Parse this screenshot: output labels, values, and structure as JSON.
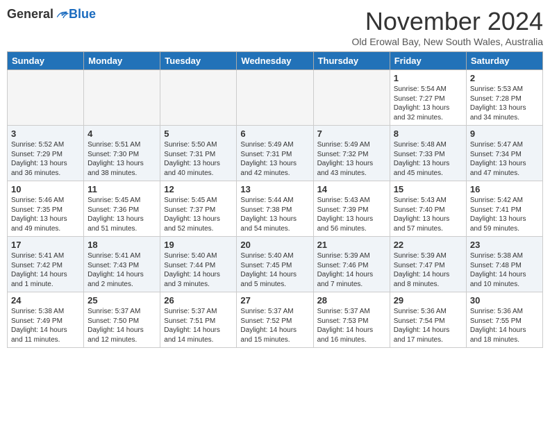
{
  "logo": {
    "general": "General",
    "blue": "Blue"
  },
  "title": "November 2024",
  "location": "Old Erowal Bay, New South Wales, Australia",
  "weekdays": [
    "Sunday",
    "Monday",
    "Tuesday",
    "Wednesday",
    "Thursday",
    "Friday",
    "Saturday"
  ],
  "weeks": [
    [
      {
        "day": "",
        "info": ""
      },
      {
        "day": "",
        "info": ""
      },
      {
        "day": "",
        "info": ""
      },
      {
        "day": "",
        "info": ""
      },
      {
        "day": "",
        "info": ""
      },
      {
        "day": "1",
        "info": "Sunrise: 5:54 AM\nSunset: 7:27 PM\nDaylight: 13 hours\nand 32 minutes."
      },
      {
        "day": "2",
        "info": "Sunrise: 5:53 AM\nSunset: 7:28 PM\nDaylight: 13 hours\nand 34 minutes."
      }
    ],
    [
      {
        "day": "3",
        "info": "Sunrise: 5:52 AM\nSunset: 7:29 PM\nDaylight: 13 hours\nand 36 minutes."
      },
      {
        "day": "4",
        "info": "Sunrise: 5:51 AM\nSunset: 7:30 PM\nDaylight: 13 hours\nand 38 minutes."
      },
      {
        "day": "5",
        "info": "Sunrise: 5:50 AM\nSunset: 7:31 PM\nDaylight: 13 hours\nand 40 minutes."
      },
      {
        "day": "6",
        "info": "Sunrise: 5:49 AM\nSunset: 7:31 PM\nDaylight: 13 hours\nand 42 minutes."
      },
      {
        "day": "7",
        "info": "Sunrise: 5:49 AM\nSunset: 7:32 PM\nDaylight: 13 hours\nand 43 minutes."
      },
      {
        "day": "8",
        "info": "Sunrise: 5:48 AM\nSunset: 7:33 PM\nDaylight: 13 hours\nand 45 minutes."
      },
      {
        "day": "9",
        "info": "Sunrise: 5:47 AM\nSunset: 7:34 PM\nDaylight: 13 hours\nand 47 minutes."
      }
    ],
    [
      {
        "day": "10",
        "info": "Sunrise: 5:46 AM\nSunset: 7:35 PM\nDaylight: 13 hours\nand 49 minutes."
      },
      {
        "day": "11",
        "info": "Sunrise: 5:45 AM\nSunset: 7:36 PM\nDaylight: 13 hours\nand 51 minutes."
      },
      {
        "day": "12",
        "info": "Sunrise: 5:45 AM\nSunset: 7:37 PM\nDaylight: 13 hours\nand 52 minutes."
      },
      {
        "day": "13",
        "info": "Sunrise: 5:44 AM\nSunset: 7:38 PM\nDaylight: 13 hours\nand 54 minutes."
      },
      {
        "day": "14",
        "info": "Sunrise: 5:43 AM\nSunset: 7:39 PM\nDaylight: 13 hours\nand 56 minutes."
      },
      {
        "day": "15",
        "info": "Sunrise: 5:43 AM\nSunset: 7:40 PM\nDaylight: 13 hours\nand 57 minutes."
      },
      {
        "day": "16",
        "info": "Sunrise: 5:42 AM\nSunset: 7:41 PM\nDaylight: 13 hours\nand 59 minutes."
      }
    ],
    [
      {
        "day": "17",
        "info": "Sunrise: 5:41 AM\nSunset: 7:42 PM\nDaylight: 14 hours\nand 1 minute."
      },
      {
        "day": "18",
        "info": "Sunrise: 5:41 AM\nSunset: 7:43 PM\nDaylight: 14 hours\nand 2 minutes."
      },
      {
        "day": "19",
        "info": "Sunrise: 5:40 AM\nSunset: 7:44 PM\nDaylight: 14 hours\nand 3 minutes."
      },
      {
        "day": "20",
        "info": "Sunrise: 5:40 AM\nSunset: 7:45 PM\nDaylight: 14 hours\nand 5 minutes."
      },
      {
        "day": "21",
        "info": "Sunrise: 5:39 AM\nSunset: 7:46 PM\nDaylight: 14 hours\nand 7 minutes."
      },
      {
        "day": "22",
        "info": "Sunrise: 5:39 AM\nSunset: 7:47 PM\nDaylight: 14 hours\nand 8 minutes."
      },
      {
        "day": "23",
        "info": "Sunrise: 5:38 AM\nSunset: 7:48 PM\nDaylight: 14 hours\nand 10 minutes."
      }
    ],
    [
      {
        "day": "24",
        "info": "Sunrise: 5:38 AM\nSunset: 7:49 PM\nDaylight: 14 hours\nand 11 minutes."
      },
      {
        "day": "25",
        "info": "Sunrise: 5:37 AM\nSunset: 7:50 PM\nDaylight: 14 hours\nand 12 minutes."
      },
      {
        "day": "26",
        "info": "Sunrise: 5:37 AM\nSunset: 7:51 PM\nDaylight: 14 hours\nand 14 minutes."
      },
      {
        "day": "27",
        "info": "Sunrise: 5:37 AM\nSunset: 7:52 PM\nDaylight: 14 hours\nand 15 minutes."
      },
      {
        "day": "28",
        "info": "Sunrise: 5:37 AM\nSunset: 7:53 PM\nDaylight: 14 hours\nand 16 minutes."
      },
      {
        "day": "29",
        "info": "Sunrise: 5:36 AM\nSunset: 7:54 PM\nDaylight: 14 hours\nand 17 minutes."
      },
      {
        "day": "30",
        "info": "Sunrise: 5:36 AM\nSunset: 7:55 PM\nDaylight: 14 hours\nand 18 minutes."
      }
    ]
  ]
}
